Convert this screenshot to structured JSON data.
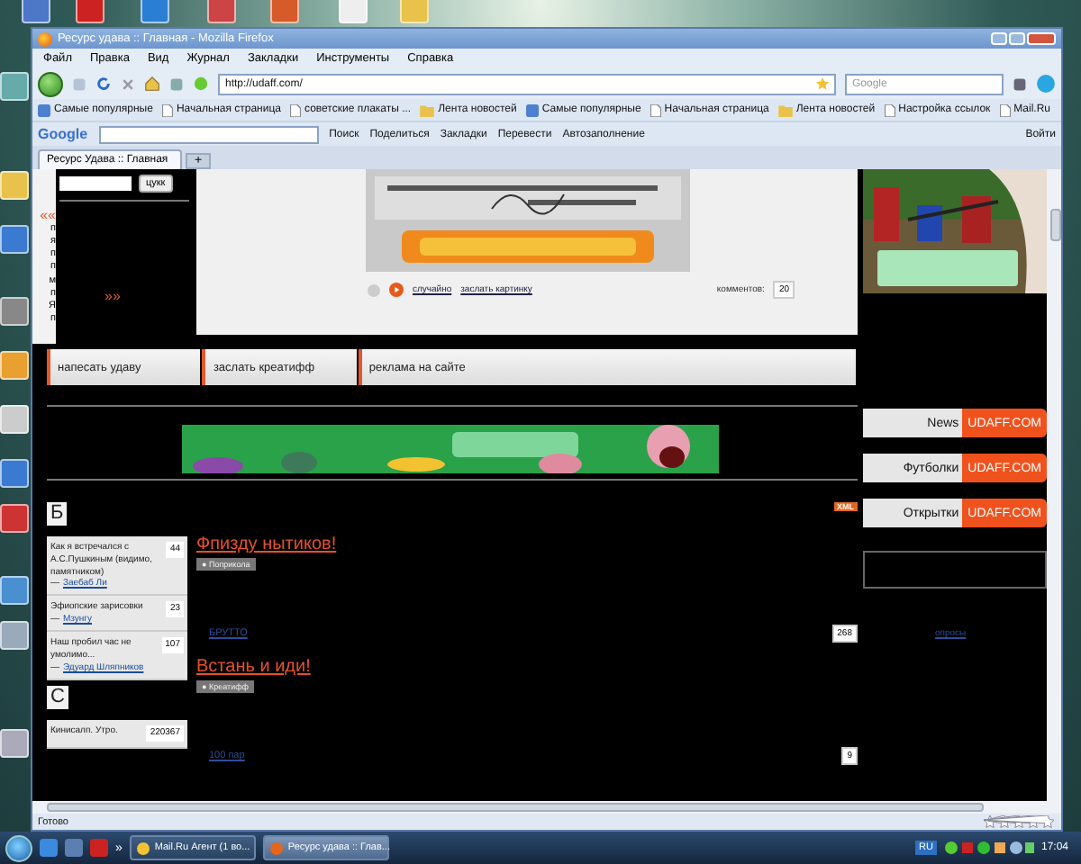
{
  "window": {
    "title": "Ресурс удава :: Главная - Mozilla Firefox"
  },
  "menu": [
    "Файл",
    "Правка",
    "Вид",
    "Журнал",
    "Закладки",
    "Инструменты",
    "Справка"
  ],
  "navigation": {
    "url": "http://udaff.com/",
    "search_placeholder": "Google"
  },
  "bookmarks": [
    {
      "label": "Самые популярные",
      "kind": "feed"
    },
    {
      "label": "Начальная страница",
      "kind": "page"
    },
    {
      "label": "советские плакаты ...",
      "kind": "page"
    },
    {
      "label": "Лента новостей",
      "kind": "folder"
    },
    {
      "label": "Самые популярные",
      "kind": "feed"
    },
    {
      "label": "Начальная страница",
      "kind": "page"
    },
    {
      "label": "Лента новостей",
      "kind": "folder"
    },
    {
      "label": "Настройка ссылок",
      "kind": "page"
    },
    {
      "label": "Mail.Ru",
      "kind": "page"
    }
  ],
  "google_toolbar": {
    "logo": "Google",
    "items": [
      "Поиск",
      "Поделиться",
      "Закладки",
      "Перевести",
      "Автозаполнение"
    ],
    "sign_in": "Войти"
  },
  "tabs": [
    {
      "label": "Ресурс Удава :: Главная",
      "selected": true
    }
  ],
  "new_tab": "+",
  "page": {
    "search_button": "цукк",
    "back_mark": "««",
    "forward_mark": "»»",
    "gutter_letters": [
      "п",
      "я",
      "п",
      "п",
      "м",
      "п",
      "Я",
      "п"
    ],
    "picture_controls": {
      "random": "случайно",
      "submit": "заслать картинку",
      "comments_label": "комментов:",
      "comments": "20"
    },
    "nav_links": [
      "напесать удаву",
      "заслать креатифф",
      "реклама на сайте"
    ],
    "xml_badge": "XML",
    "sections": [
      {
        "heading": "Б",
        "items": [
          {
            "title": "Как я встречался с А.С.Пушкиным (видимо, памятником)",
            "count": "44",
            "dash": "—",
            "author": "Заебаб Ли"
          },
          {
            "title": "Эфиопские зарисовки",
            "count": "23",
            "dash": "—",
            "author": "Мзунгу"
          },
          {
            "title": "Наш пробил час не умолимо...",
            "count": "107",
            "dash": "—",
            "author": "Эдуард Шляпников"
          }
        ]
      },
      {
        "heading": "С",
        "items": [
          {
            "title": "Кинисалп. Утро.",
            "count": "220367"
          }
        ]
      }
    ],
    "feed": [
      {
        "kind": "article",
        "title": "Фпизду нытиков!",
        "bullet": "●",
        "tag": "Поприкола"
      },
      {
        "kind": "link",
        "title": "БРУТТО",
        "count": "268"
      },
      {
        "kind": "article",
        "title": "Встань и иди!",
        "bullet": "●",
        "tag": "Креатифф"
      },
      {
        "kind": "link",
        "title": "100 пар",
        "count": "9"
      }
    ],
    "promo_buttons": [
      {
        "label": "News",
        "brand": "UDAFF.COM"
      },
      {
        "label": "Футболки",
        "brand": "UDAFF.COM"
      },
      {
        "label": "Открытки",
        "brand": "UDAFF.COM"
      }
    ],
    "poll_link": "опросы"
  },
  "status": "Готово",
  "taskbar": {
    "quick_more": "»",
    "tasks": [
      {
        "label": "Mail.Ru Агент (1 во...",
        "selected": false
      },
      {
        "label": "Ресурс удава :: Глав...",
        "selected": true
      }
    ],
    "language": "RU",
    "clock": "17:04"
  }
}
